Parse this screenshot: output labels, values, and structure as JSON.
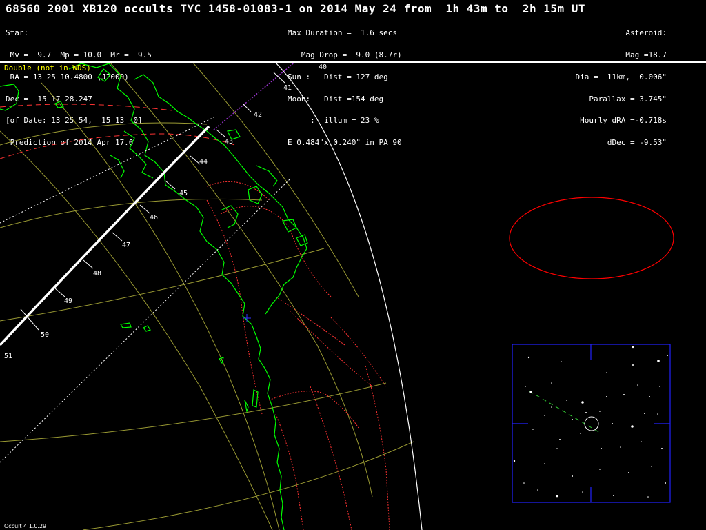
{
  "header": {
    "title": "68560 2001 XB120 occults TYC 1458-01083-1 on 2014 May 24 from  1h 43m to  2h 15m UT"
  },
  "star_info": [
    "Star:",
    " Mv =  9.7  Mp = 10.0  Mr =  9.5",
    " RA = 13 25 10.4800 (J2000)",
    "Dec =  15 17 28.247",
    "[of Date: 13 25 54,  15 13  0]",
    " Prediction of 2014 Apr 17.0"
  ],
  "event_info": [
    "Max Duration =  1.6 secs",
    "   Mag Drop =  9.0 (8.7r)",
    "Sun :   Dist = 127 deg",
    "Moon:   Dist =154 deg",
    "     :  illum = 23 %",
    "E 0.484\"x 0.240\" in PA 90"
  ],
  "asteroid_info": [
    "Asteroid:",
    "Mag =18.7",
    "Dia =  11km,  0.006\"",
    "Parallax = 3.745\"",
    "Hourly dRA =-0.718s",
    "dDec = -9.53\""
  ],
  "double_note": "Double (not in WDS)",
  "version": "Occult 4.1.0.29",
  "colors": {
    "coastline": "#00ff00",
    "borders": "#ff3333",
    "graticule": "#9a9a33",
    "limb": "#ffffff",
    "path": "#ffffff",
    "path_limits": "#ffffff",
    "sigma": "#ff3333",
    "time_ext": "#9933cc",
    "ellipse": "#ff0000",
    "finder_frame": "#2222ff"
  },
  "time_labels": [
    "40",
    "41",
    "42",
    "43",
    "44",
    "45",
    "46",
    "47",
    "48",
    "49",
    "50",
    "51"
  ],
  "icons": {
    "center_marker": "cross-icon",
    "target_star": "circle-icon"
  }
}
